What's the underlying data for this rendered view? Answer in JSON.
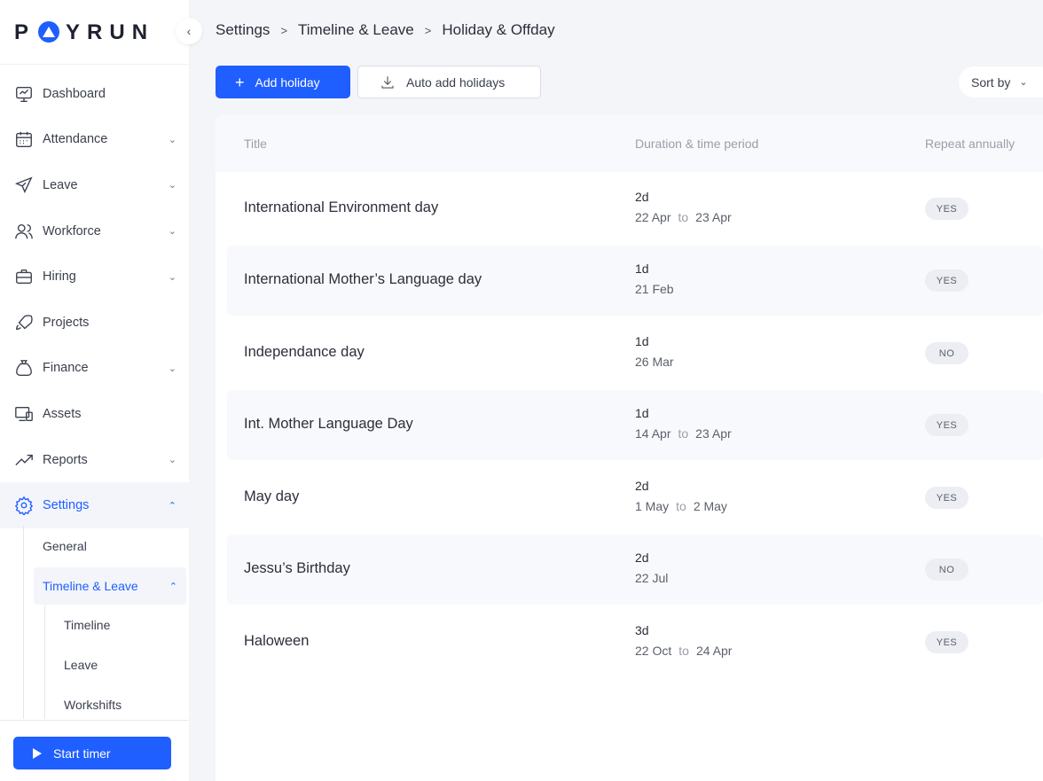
{
  "brand": {
    "logo_text_left": "P",
    "logo_text_right": "YRUN"
  },
  "sidebar": {
    "collapse_glyph": "‹",
    "items": [
      {
        "label": "Dashboard",
        "icon": "dashboard-icon",
        "has_chevron": false
      },
      {
        "label": "Attendance",
        "icon": "calendar-icon",
        "has_chevron": true
      },
      {
        "label": "Leave",
        "icon": "plane-icon",
        "has_chevron": true
      },
      {
        "label": "Workforce",
        "icon": "users-icon",
        "has_chevron": true
      },
      {
        "label": "Hiring",
        "icon": "briefcase-icon",
        "has_chevron": true
      },
      {
        "label": "Projects",
        "icon": "rocket-icon",
        "has_chevron": false
      },
      {
        "label": "Finance",
        "icon": "money-bag-icon",
        "has_chevron": true
      },
      {
        "label": "Assets",
        "icon": "devices-icon",
        "has_chevron": false
      },
      {
        "label": "Reports",
        "icon": "trend-icon",
        "has_chevron": true
      },
      {
        "label": "Settings",
        "icon": "gear-icon",
        "has_chevron": true,
        "active": true
      }
    ],
    "settings_sub": {
      "general": "General",
      "timeline_leave": "Timeline & Leave",
      "timeline_leave_children": [
        "Timeline",
        "Leave",
        "Workshifts"
      ]
    },
    "start_timer": "Start timer"
  },
  "breadcrumb": [
    "Settings",
    "Timeline & Leave",
    "Holiday & Offday"
  ],
  "toolbar": {
    "add_holiday": "Add holiday",
    "auto_add": "Auto add holidays",
    "sort_by": "Sort by"
  },
  "table": {
    "columns": [
      "Title",
      "Duration & time period",
      "Repeat annually"
    ],
    "rows": [
      {
        "title": "International Environment day",
        "duration": "2d",
        "from": "22 Apr",
        "to_label": "to",
        "to": "23 Apr",
        "repeat": "YES"
      },
      {
        "title": "International Mother’s Language day",
        "duration": "1d",
        "from": "21 Feb",
        "to_label": "",
        "to": "",
        "repeat": "YES"
      },
      {
        "title": "Independance day",
        "duration": "1d",
        "from": "26 Mar",
        "to_label": "",
        "to": "",
        "repeat": "NO"
      },
      {
        "title": "Int. Mother Language Day",
        "duration": "1d",
        "from": "14 Apr",
        "to_label": "to",
        "to": "23 Apr",
        "repeat": "YES"
      },
      {
        "title": "May day",
        "duration": "2d",
        "from": "1 May",
        "to_label": "to",
        "to": "2 May",
        "repeat": "YES"
      },
      {
        "title": "Jessu’s Birthday",
        "duration": "2d",
        "from": "22 Jul",
        "to_label": "",
        "to": "",
        "repeat": "NO"
      },
      {
        "title": "Haloween",
        "duration": "3d",
        "from": "22 Oct",
        "to_label": "to",
        "to": "24 Apr",
        "repeat": "YES"
      }
    ]
  },
  "colors": {
    "accent": "#1f5eff",
    "background": "#f4f5f9"
  }
}
